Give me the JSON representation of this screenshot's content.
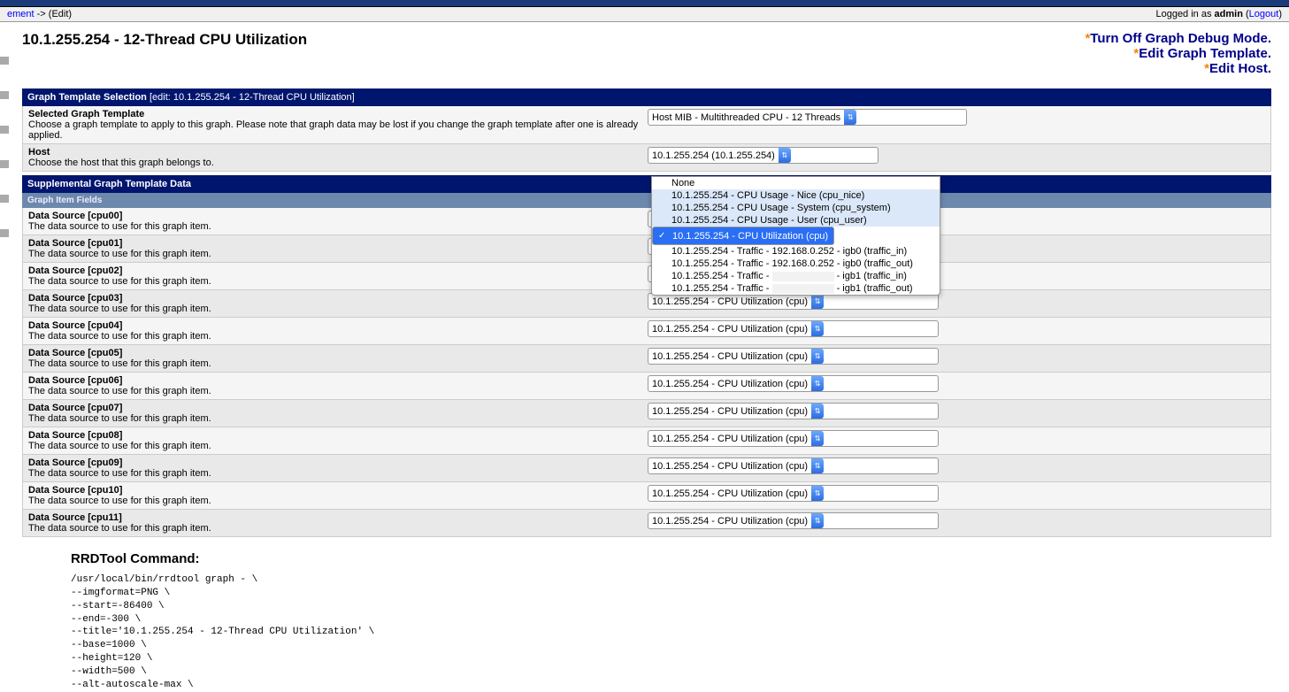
{
  "breadcrumb": {
    "left_link": "ement",
    "arrow": " -> ",
    "current": "(Edit)",
    "login_prefix": "Logged in as ",
    "user": "admin",
    "logout": "Logout"
  },
  "page_title": "10.1.255.254 - 12-Thread CPU Utilization",
  "action_links": {
    "debug": "Turn Off Graph Debug Mode.",
    "template": "Edit Graph Template.",
    "host": "Edit Host."
  },
  "section1": {
    "title": "Graph Template Selection",
    "sub": "[edit: 10.1.255.254 - 12-Thread CPU Utilization]",
    "rows": [
      {
        "name": "Selected Graph Template",
        "desc": "Choose a graph template to apply to this graph. Please note that graph data may be lost if you change the graph template after one is already applied.",
        "value": "Host MIB - Multithreaded CPU - 12 Threads",
        "w": "w355"
      },
      {
        "name": "Host",
        "desc": "Choose the host that this graph belongs to.",
        "value": "10.1.255.254 (10.1.255.254)",
        "w": "w255"
      }
    ]
  },
  "dropdown": {
    "options": [
      {
        "t": "None"
      },
      {
        "t": "10.1.255.254 - CPU Usage - Nice (cpu_nice)"
      },
      {
        "t": "10.1.255.254 - CPU Usage - System (cpu_system)"
      },
      {
        "t": "10.1.255.254 - CPU Usage - User (cpu_user)"
      },
      {
        "t": "10.1.255.254 - CPU Utilization (cpu)",
        "sel": true
      },
      {
        "t": "10.1.255.254 - Traffic - 192.168.0.252 - igb0 (traffic_in)"
      },
      {
        "t": "10.1.255.254 - Traffic - 192.168.0.252 - igb0 (traffic_out)"
      },
      {
        "t": "10.1.255.254 - Traffic - ",
        "redact": true,
        "suffix": " - igb1 (traffic_in)"
      },
      {
        "t": "10.1.255.254 - Traffic - ",
        "redact": true,
        "suffix": " - igb1 (traffic_out)"
      }
    ]
  },
  "section2": {
    "title": "Supplemental Graph Template Data",
    "subbar": "Graph Item Fields",
    "desc": "The data source to use for this graph item.",
    "value": "10.1.255.254 - CPU Utilization (cpu)",
    "items": [
      "cpu00",
      "cpu01",
      "cpu02",
      "cpu03",
      "cpu04",
      "cpu05",
      "cpu06",
      "cpu07",
      "cpu08",
      "cpu09",
      "cpu10",
      "cpu11"
    ]
  },
  "rrd": {
    "title": "RRDTool Command:",
    "cmd": "/usr/local/bin/rrdtool graph - \\\n--imgformat=PNG \\\n--start=-86400 \\\n--end=-300 \\\n--title='10.1.255.254 - 12-Thread CPU Utilization' \\\n--base=1000 \\\n--height=120 \\\n--width=500 \\\n--alt-autoscale-max \\"
  }
}
